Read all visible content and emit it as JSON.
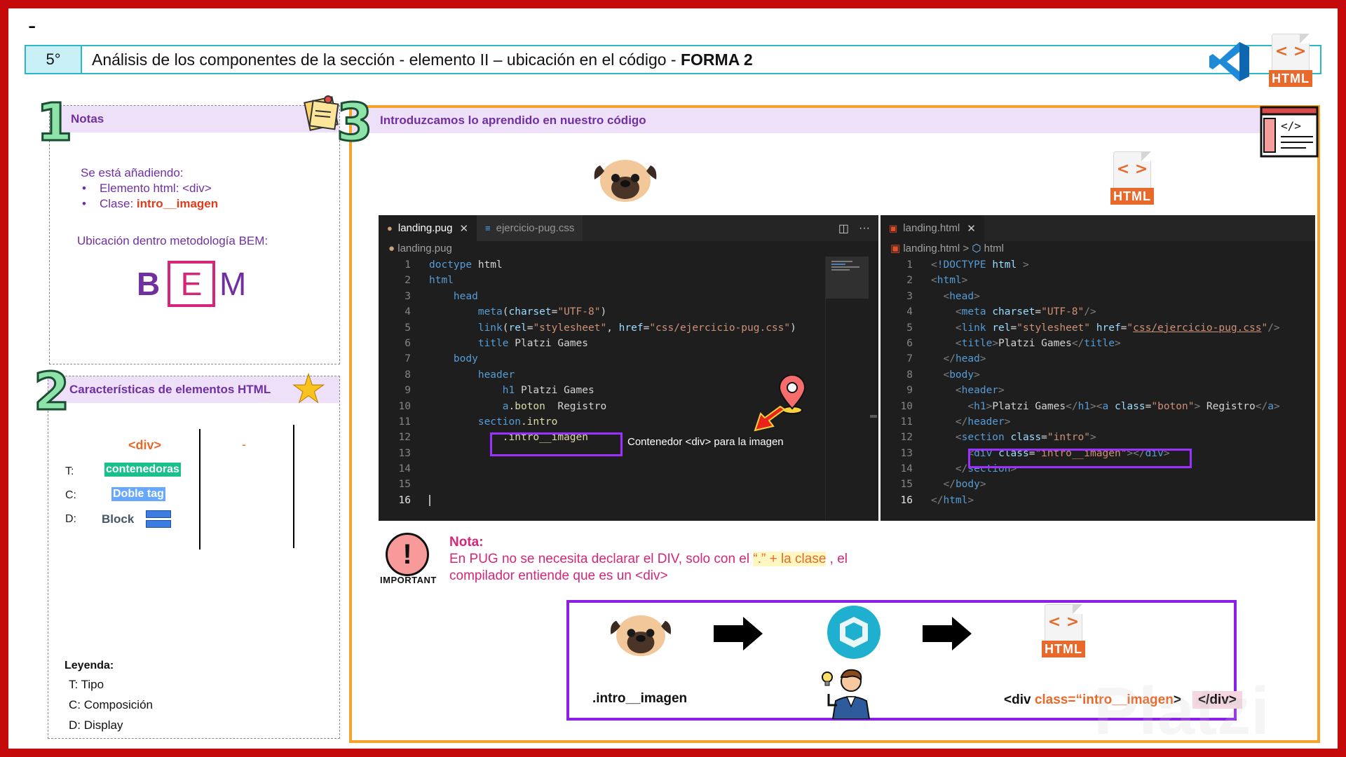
{
  "top_dash": "-",
  "header": {
    "number": "5°",
    "title_plain": "Análisis de los componentes de la sección   - elemento II – ubicación en el código - ",
    "title_bold": "FORMA 2"
  },
  "badges": {
    "html": "HTML",
    "code_glyph": "< >"
  },
  "panel1": {
    "num": "1",
    "title": "Notas",
    "intro": "Se está añadiendo:",
    "items": [
      {
        "label": "Elemento html: <div>"
      },
      {
        "prefix": "Clase: ",
        "value": "intro__imagen"
      }
    ],
    "bem_title": "Ubicación dentro metodología BEM:",
    "bem": {
      "b": "B",
      "e": "E",
      "m": "M"
    }
  },
  "panel2": {
    "num": "2",
    "title": "Características de elementos HTML",
    "col1_header": "<div>",
    "col2_header": "-",
    "rows": [
      {
        "key": "T:",
        "value": "contenedoras"
      },
      {
        "key": "C:",
        "value": "Doble tag"
      },
      {
        "key": "D:",
        "value": "Block"
      }
    ],
    "legend": {
      "title": "Leyenda:",
      "items": [
        "T:  Tipo",
        "C:  Composición",
        "D:  Display"
      ]
    }
  },
  "panel3": {
    "num": "3",
    "title": "Introduzcamos lo aprendido en nuestro código"
  },
  "editor_left": {
    "tabs": [
      {
        "label": "landing.pug",
        "active": true
      },
      {
        "label": "ejercicio-pug.css",
        "active": false
      }
    ],
    "breadcrumb": "landing.pug",
    "lines": [
      "1",
      "2",
      "3",
      "4",
      "5",
      "6",
      "7",
      "8",
      "9",
      "10",
      "11",
      "12",
      "13",
      "14",
      "15",
      "16"
    ]
  },
  "editor_right": {
    "tabs": [
      {
        "label": "landing.html",
        "active": true
      }
    ],
    "breadcrumb_file": "landing.html",
    "breadcrumb_sep": ">",
    "breadcrumb_node": "html"
  },
  "annotation": "Contenedor <div> para la imagen",
  "nota": {
    "heading": "Nota:",
    "line1_a": "En PUG no se necesita declarar el DIV, solo con el ",
    "line1_hl": "“.” + la clase",
    "line1_b": " , el",
    "line2": "compilador entiende que es un <div>",
    "important_word": "IMPORTANT"
  },
  "flow": {
    "pug_label": ".intro__imagen",
    "html_open": "<div ",
    "html_class": "class=“intro__imagen",
    "html_gt": ">",
    "html_close": "</div>"
  },
  "watermark": "Platzi",
  "colors": {
    "frame": "#c40a0a",
    "purple": "#7030a0",
    "orange": "#e7692b",
    "pink": "#d6267a",
    "highlight_box": "#9b30ff",
    "panel3_border": "#f7a22c"
  }
}
